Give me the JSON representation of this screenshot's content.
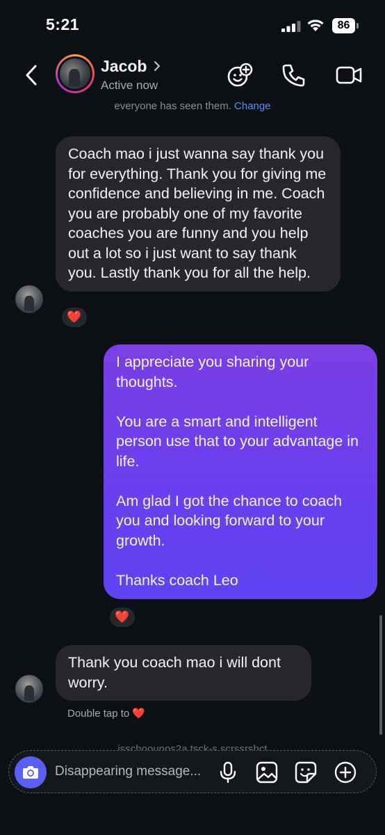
{
  "status_bar": {
    "time": "5:21",
    "battery_level": "86"
  },
  "header": {
    "contact_name": "Jacob",
    "status": "Active now",
    "icons": [
      "back-arrow-icon",
      "chevron-right-icon",
      "effects-icon",
      "phone-icon",
      "video-camera-icon"
    ]
  },
  "chat": {
    "notice_text": "everyone has seen them.",
    "notice_link": "Change",
    "messages": [
      {
        "sender": "Jacob",
        "direction": "incoming",
        "paragraphs": [
          "Coach mao i just wanna say thank you for everything. Thank you for giving me confidence and believing in me. Coach you are probably one of my favorite coaches you are funny and you help out a lot so i just want to say thank you. Lastly thank you for all the help."
        ],
        "reaction": "❤️"
      },
      {
        "sender": "me",
        "direction": "outgoing",
        "paragraphs": [
          "I appreciate you sharing your thoughts.",
          "You are a smart and intelligent person use that to your advantage in life.",
          "Am glad I got the chance to coach you and looking forward to your growth.",
          "Thanks coach Leo"
        ],
        "reaction": "❤️"
      },
      {
        "sender": "Jacob",
        "direction": "incoming",
        "paragraphs": [
          "Thank you coach mao i will dont worry."
        ],
        "reaction": ""
      }
    ],
    "double_tap_hint": "Double tap to",
    "double_tap_emoji": "❤️"
  },
  "composer": {
    "placeholder": "Disappearing message...",
    "value": "",
    "faded_notice": "isschoounos2a.tsck-s scrssrsbct",
    "icons": [
      "camera-icon",
      "microphone-icon",
      "gallery-icon",
      "sticker-icon",
      "plus-icon"
    ]
  },
  "colors": {
    "background": "#0c0f14",
    "incoming_bubble": "#26282d",
    "outgoing_bubble_top": "#7b3fe4",
    "outgoing_bubble_bottom": "#5f44f2",
    "camera_button": "#5b5ef4",
    "heart": "#e8173a",
    "link": "#5b8df8"
  }
}
